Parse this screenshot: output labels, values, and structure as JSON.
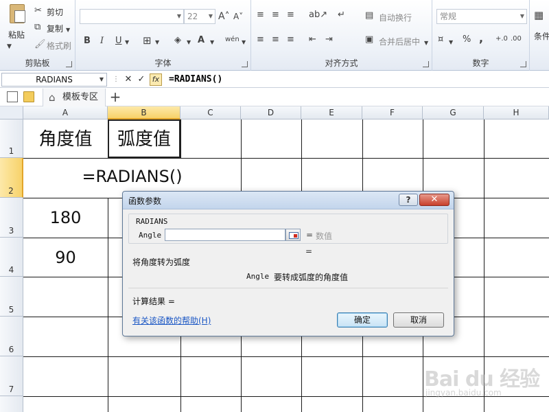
{
  "ribbon": {
    "clipboard": {
      "paste_label": "粘贴",
      "cut_label": "剪切",
      "copy_label": "复制",
      "format_painter_label": "格式刷",
      "group_label": "剪贴板"
    },
    "font": {
      "font_name": "",
      "font_size": "22",
      "grow_icon": "A˄",
      "shrink_icon": "A˅",
      "bold": "B",
      "italic": "I",
      "underline": "U",
      "phonetic": "wén",
      "group_label": "字体"
    },
    "alignment": {
      "wrap_text_label": "自动换行",
      "merge_center_label": "合并后居中",
      "group_label": "对齐方式"
    },
    "number": {
      "format_value": "常规",
      "percent": "%",
      "comma": ",",
      "group_label": "数字"
    },
    "cond_label": "条件"
  },
  "formula_bar": {
    "name_box": "RADIANS",
    "cancel_icon": "✕",
    "enter_icon": "✓",
    "fx_label": "fx",
    "formula": "=RADIANS()"
  },
  "tab_bar": {
    "tab_label": "模板专区",
    "new_tab_icon": "+"
  },
  "grid": {
    "columns": [
      "A",
      "B",
      "C",
      "D",
      "E",
      "F",
      "G",
      "H"
    ],
    "rows": [
      "1",
      "2",
      "3",
      "4",
      "5",
      "6",
      "7"
    ],
    "cells": {
      "A1": "角度值",
      "B1": "弧度值",
      "A2": "=RADIANS()",
      "A3": "180",
      "A4": "90"
    }
  },
  "dialog": {
    "title": "函数参数",
    "help_icon": "?",
    "close_icon": "✕",
    "function_name": "RADIANS",
    "arg_label": "Angle",
    "arg_value": "",
    "arg_equals": "=",
    "arg_hint": "数值",
    "result_equals": "=",
    "description": "将角度转为弧度",
    "arg_desc_name": "Angle",
    "arg_description": "要转成弧度的角度值",
    "calc_result_label": "计算结果 =",
    "help_link": "有关该函数的帮助(H)",
    "ok_label": "确定",
    "cancel_label": "取消"
  },
  "watermark": {
    "logo_text": "Bai du 经验",
    "url": "jingyan.baidu.com"
  }
}
